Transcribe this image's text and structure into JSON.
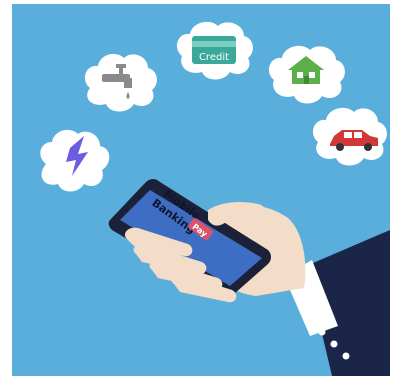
{
  "illustration": {
    "phone_screen": {
      "line1": "Mobile",
      "line2": "Banking",
      "button": "Pay"
    },
    "bubbles": [
      {
        "icon": "lightning-icon"
      },
      {
        "icon": "water-faucet-icon"
      },
      {
        "icon": "credit-card-icon",
        "label": "Credit"
      },
      {
        "icon": "house-icon"
      },
      {
        "icon": "car-icon"
      }
    ]
  },
  "colors": {
    "background": "#5aaedc",
    "bubble": "#ffffff",
    "phone_body": "#1c2038",
    "phone_screen": "#3d6ec4",
    "pay_button": "#d9546a",
    "skin": "#f3dcc8",
    "sleeve": "#1b2547",
    "lightning": "#6a5de0",
    "faucet": "#8a8a8a",
    "card": "#3aa89a",
    "house": "#5bb04a",
    "car": "#d23838"
  }
}
